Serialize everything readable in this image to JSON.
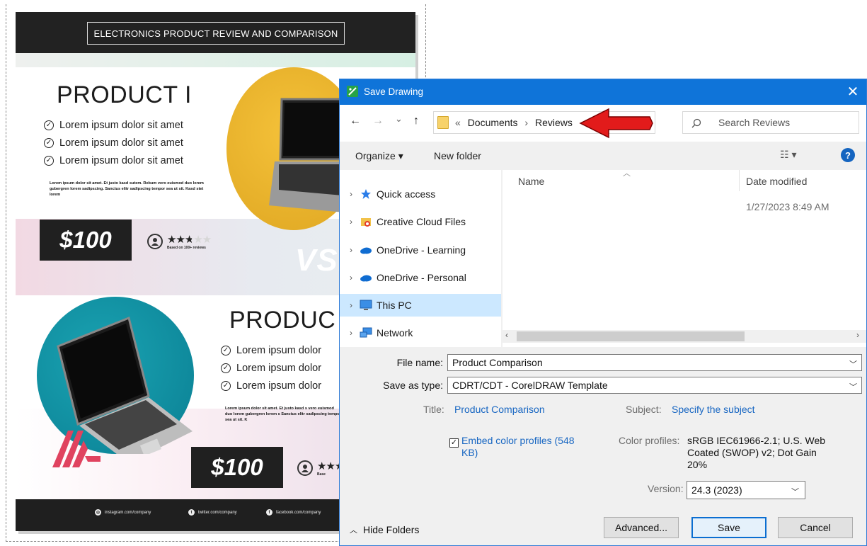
{
  "poster": {
    "header_title": "ELECTRONICS PRODUCT REVIEW AND COMPARISON",
    "product1_title": "PRODUCT I",
    "product2_title": "PRODUC",
    "bullet": "Lorem ipsum dolor sit amet",
    "bullet_cut": "Lorem ipsum dolor",
    "paragraph": "Lorem ipsum dolor sit amet. Et justo kasd sutem. Rebum vero euismod duo lorem gubergren lorem sadipscing. Sanctus elitr sadipscing tempor sea ut sit. Kasd stet lorem",
    "paragraph_cut": "Lorem ipsum dolor sit amet. Et justo kasd s vero euismod duo lorem gubergren lorem s Sanctus elitr sadipscing tempor sea ut sit. K",
    "price": "$100",
    "stars": "★★★★★",
    "rating": 3.5,
    "rating_sub": "Based on 100+ reviews",
    "rating_sub_cut": "Base",
    "vs": "VS.",
    "social": [
      "instagram.com/company",
      "twitter.com/company",
      "facebook.com/company"
    ]
  },
  "dialog": {
    "title": "Save Drawing",
    "close": "✕",
    "nav": {
      "back": "←",
      "forward": "→",
      "recent": "⌄",
      "up": "↑"
    },
    "breadcrumb": {
      "prefix": "«",
      "part1": "Documents",
      "sep": "›",
      "part2": "Reviews"
    },
    "refresh": "⟳",
    "search_placeholder": "Search Reviews",
    "organize": "Organize ▾",
    "new_folder": "New folder",
    "view": "☷ ▾",
    "help": "?",
    "sidebar": [
      {
        "label": "Quick access",
        "icon": "star-icon"
      },
      {
        "label": "Creative Cloud Files",
        "icon": "creative-cloud-icon"
      },
      {
        "label": "OneDrive - Learning",
        "icon": "cloud-icon"
      },
      {
        "label": "OneDrive - Personal",
        "icon": "cloud-icon"
      },
      {
        "label": "This PC",
        "icon": "computer-icon"
      },
      {
        "label": "Network",
        "icon": "network-icon"
      }
    ],
    "columns": {
      "name": "Name",
      "date": "Date modified"
    },
    "rows": [
      {
        "date": "1/27/2023 8:49 AM"
      }
    ],
    "file_name_label": "File name:",
    "file_name": "Product Comparison",
    "save_type_label": "Save as type:",
    "save_type": "CDRT/CDT - CorelDRAW Template",
    "title_label": "Title:",
    "title_value": "Product Comparison",
    "subject_label": "Subject:",
    "subject_value": "Specify the subject",
    "embed_label": "Embed color profiles (548 KB)",
    "embed_checked": true,
    "profiles_label": "Color profiles:",
    "profiles_value": "sRGB IEC61966-2.1; U.S. Web Coated (SWOP) v2; Dot Gain 20%",
    "version_label": "Version:",
    "version_value": "24.3 (2023)",
    "hide_folders": "Hide Folders",
    "advanced": "Advanced...",
    "save": "Save",
    "cancel": "Cancel"
  },
  "colors": {
    "titlebar": "#0f74d9",
    "accent_red": "#e21b1b",
    "link": "#1766c2",
    "selected": "#cce8ff"
  }
}
